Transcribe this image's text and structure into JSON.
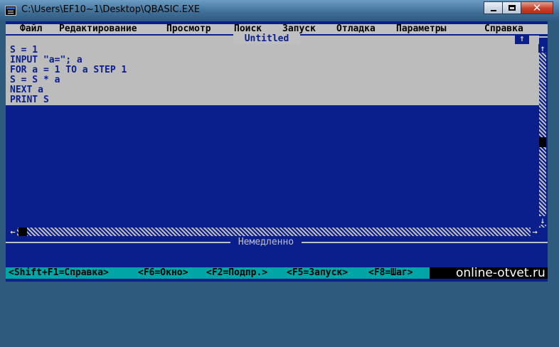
{
  "window": {
    "title": "C:\\Users\\EF10~1\\Desktop\\QBASIC.EXE",
    "close_glyph": "✕"
  },
  "menu": [
    {
      "id": "file",
      "label": "Файл"
    },
    {
      "id": "edit",
      "label": "Редактирование"
    },
    {
      "id": "view",
      "label": "Просмотр"
    },
    {
      "id": "search",
      "label": "Поиск"
    },
    {
      "id": "run",
      "label": "Запуск"
    },
    {
      "id": "debug",
      "label": "Отладка"
    },
    {
      "id": "options",
      "label": "Параметры"
    },
    {
      "id": "help",
      "label": "Справка"
    }
  ],
  "editor": {
    "title": "Untitled",
    "restore_badge": "↑",
    "lines": [
      "S = 1",
      "INPUT \"a=\"; a",
      "FOR a = 1 TO a STEP 1",
      "S = S * a",
      "NEXT a",
      "PRINT S"
    ]
  },
  "scrollbar": {
    "up": "↑",
    "down": "↓",
    "left": "←",
    "right": "→"
  },
  "immediate": {
    "title": "Немедленно"
  },
  "status": [
    "<Shift+F1=Справка>",
    "<F6=Окно>",
    "<F2=Подпр.>",
    "<F5=Запуск>",
    "<F8=Шаг>"
  ],
  "watermark": "online-otvet.ru",
  "colors": {
    "console_background": "#0a1e8c",
    "code_text": "#0a1e8c",
    "editor_highlight": "#bcbcbc",
    "menu_background": "#c0c0c0",
    "status_background": "#00a6a6"
  }
}
